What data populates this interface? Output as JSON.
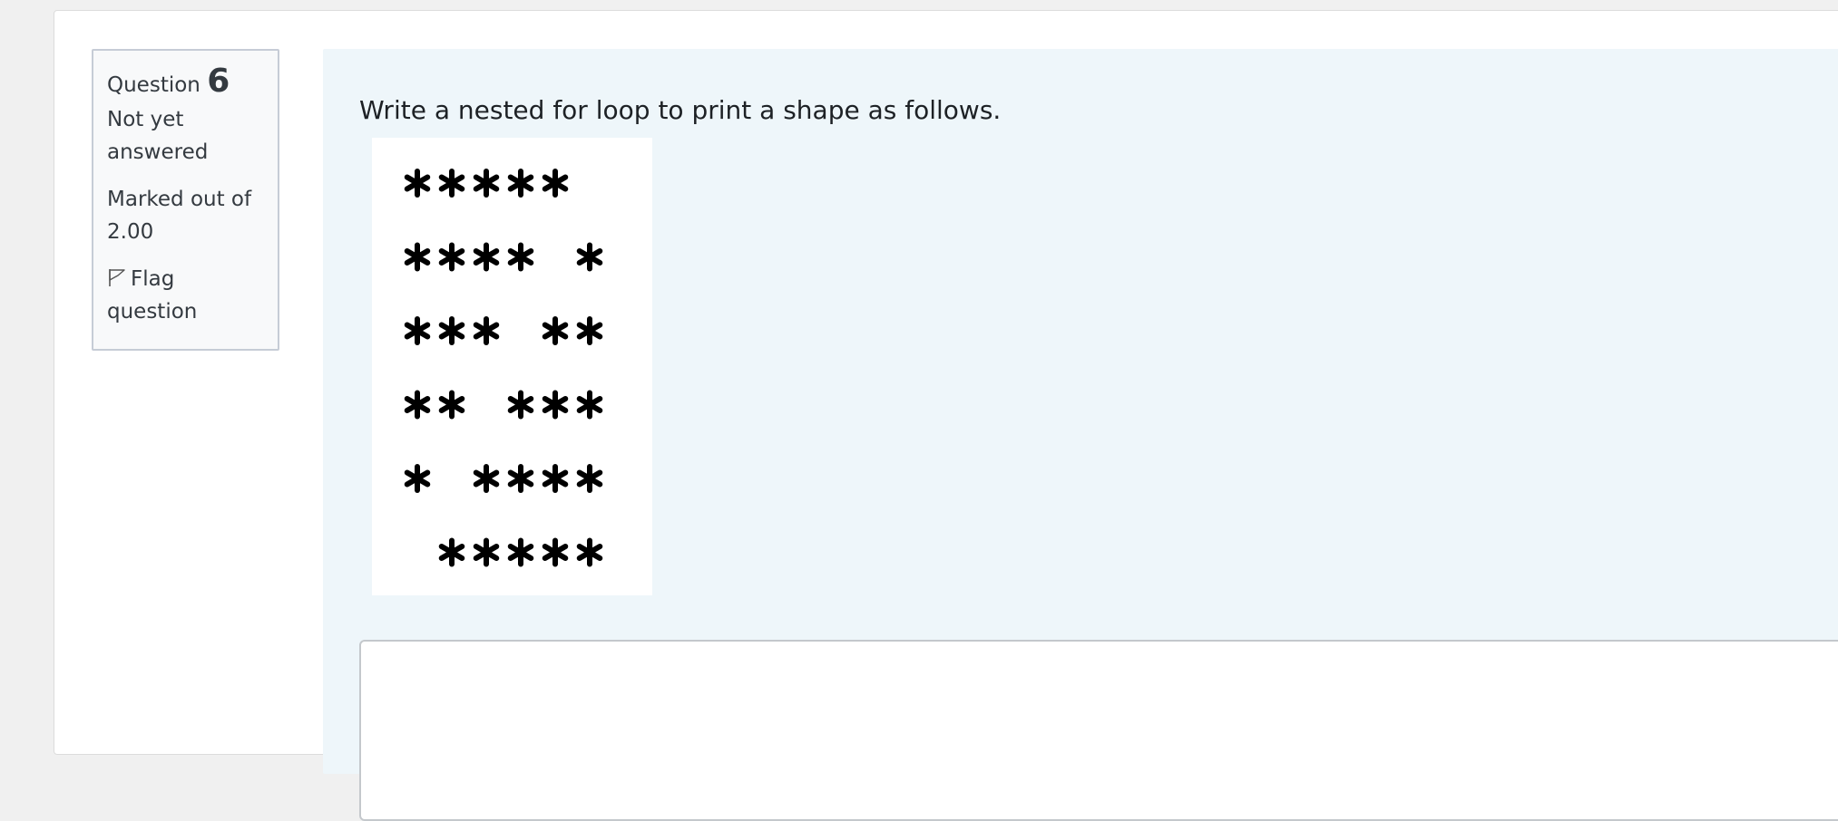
{
  "question": {
    "label": "Question",
    "number": "6",
    "state": "Not yet answered",
    "grade": "Marked out of 2.00",
    "flag_label": "Flag question"
  },
  "qtext": "Write a nested for loop to print a shape as follows.",
  "figure": {
    "rows": [
      "*****",
      "**** *",
      "*** **",
      "** ***",
      "* ****",
      " *****"
    ]
  },
  "answer": {
    "value": ""
  },
  "colors": {
    "page_bg": "#f0f0f0",
    "info_bg": "#f8f9fa",
    "info_border": "#c6ccd6",
    "content_bg": "#eef6fa"
  },
  "icons": {
    "flag": "flag-icon"
  }
}
